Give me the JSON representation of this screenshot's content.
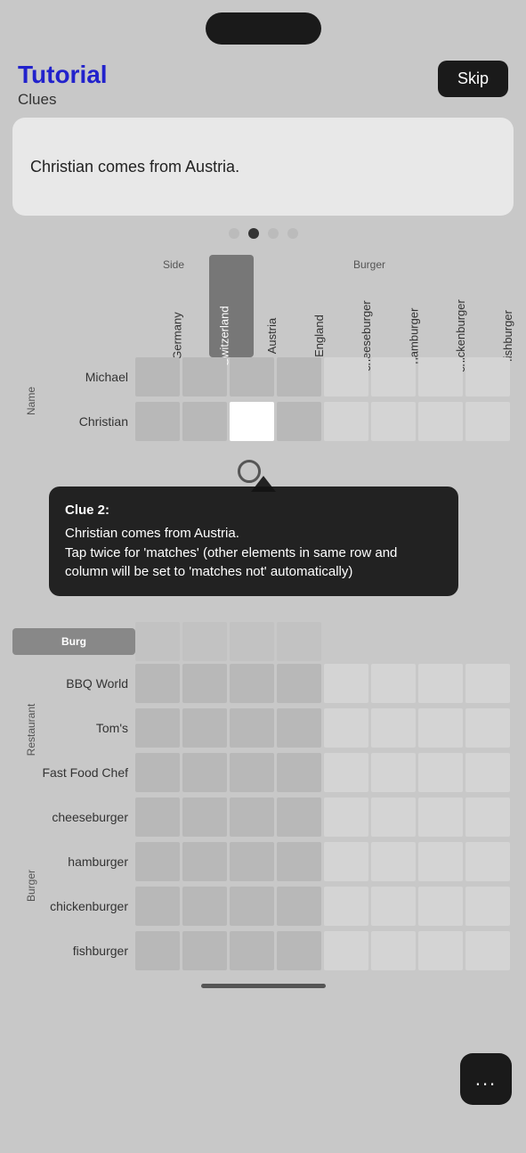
{
  "app": {
    "top_pill": "",
    "header": {
      "title": "Tutorial",
      "subtitle": "Clues",
      "skip_label": "Skip"
    },
    "clue_card": {
      "text": "Christian comes from Austria."
    },
    "dots": [
      {
        "active": false
      },
      {
        "active": true
      },
      {
        "active": false
      },
      {
        "active": false
      }
    ],
    "columns": {
      "side_group_label": "Side",
      "burger_group_label": "Burger",
      "items": [
        "Germany",
        "Switzerland",
        "Austria",
        "England",
        "cheeseburger",
        "hamburger",
        "chickenburger",
        "fishburger"
      ]
    },
    "rows": {
      "name_group_label": "Name",
      "restaurant_group_label": "Restaurant",
      "burger_group_label": "Burger",
      "name_items": [
        "Michael",
        "Christian"
      ],
      "burger_section_label": "Burg",
      "restaurant_items": [
        "BBQ World",
        "Tom's",
        "Fast Food Chef"
      ],
      "burger_items": [
        "cheeseburger",
        "hamburger",
        "chickenburger",
        "fishburger"
      ]
    },
    "clue_popup": {
      "title": "Clue 2:",
      "line1": "Christian comes from Austria.",
      "line2": "Tap twice for 'matches' (other elements in same row and column will be set to 'matches not' automatically)"
    },
    "fab": {
      "dots": "..."
    }
  }
}
